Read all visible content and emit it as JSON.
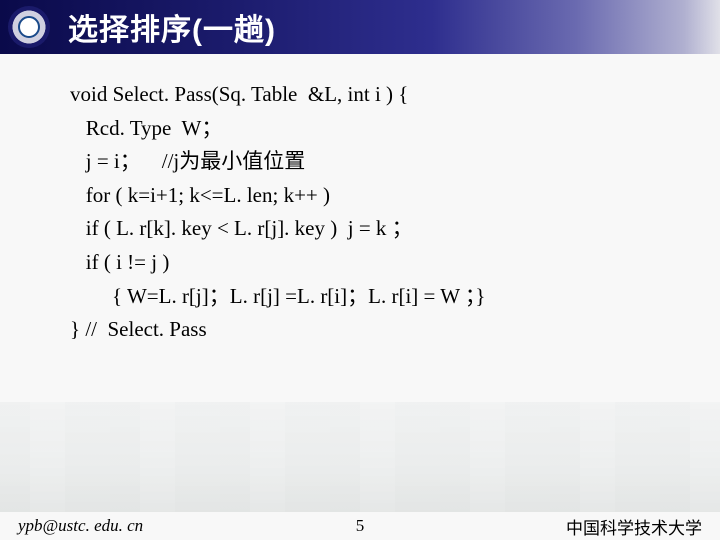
{
  "header": {
    "title": "选择排序(一趟)"
  },
  "code": {
    "l1": "void Select. Pass(Sq. Table  &L, int i ) {",
    "l2": "   Rcd. Type  W；",
    "l3": "   j = i；    //j为最小值位置",
    "l4": "   for ( k=i+1; k<=L. len; k++ )",
    "l5": "   if ( L. r[k]. key < L. r[j]. key )  j = k ；",
    "l6": "   if ( i != j )",
    "l7": "        { W=L. r[j]；L. r[j] =L. r[i]；L. r[i] = W ；}",
    "l8": "} //  Select. Pass"
  },
  "footer": {
    "left": "ypb@ustc. edu. cn",
    "center": "5",
    "right": "中国科学技术大学"
  }
}
